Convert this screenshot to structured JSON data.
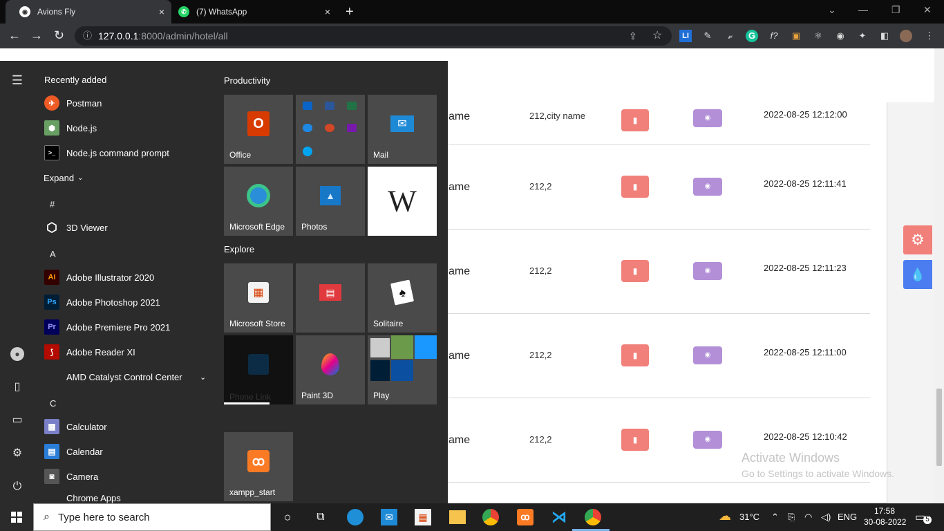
{
  "browser": {
    "tabs": [
      {
        "title": "Avions Fly",
        "close": "×"
      },
      {
        "title": "(7) WhatsApp",
        "close": "×"
      }
    ],
    "new_tab": "+",
    "window_controls": {
      "dropdown": "⌄",
      "minimize": "—",
      "restore": "❐",
      "close": "✕"
    },
    "url_host": "127.0.0.1",
    "url_path": ":8000/admin/hotel/all"
  },
  "table_rows": [
    {
      "name": "ame",
      "city": "212,city name",
      "date": "2022-08-25 12:12:00"
    },
    {
      "name": "ame",
      "city": "212,2",
      "date": "2022-08-25 12:11:41"
    },
    {
      "name": "ame",
      "city": "212,2",
      "date": "2022-08-25 12:11:23"
    },
    {
      "name": "ame",
      "city": "212,2",
      "date": "2022-08-25 12:11:00"
    },
    {
      "name": "ame",
      "city": "212,2",
      "date": "2022-08-25 12:10:42"
    }
  ],
  "watermark": {
    "line1": "Activate Windows",
    "line2": "Go to Settings to activate Windows."
  },
  "start_menu": {
    "recently_added": "Recently added",
    "expand": "Expand",
    "apps": [
      {
        "label": "Postman",
        "icon": "postman-icon",
        "color": "#ef5b25"
      },
      {
        "label": "Node.js",
        "icon": "nodejs-icon",
        "color": "#68a063"
      },
      {
        "label": "Node.js command prompt",
        "icon": "terminal-icon",
        "color": "#000000"
      }
    ],
    "letters": {
      "hash": "#",
      "a": "A",
      "c": "C"
    },
    "apps_hash": [
      {
        "label": "3D Viewer",
        "icon": "cube-icon"
      }
    ],
    "apps_a": [
      {
        "label": "Adobe Illustrator 2020",
        "abbr": "Ai",
        "color": "#330000",
        "fg": "#ff9a00"
      },
      {
        "label": "Adobe Photoshop 2021",
        "abbr": "Ps",
        "color": "#001e36",
        "fg": "#31a8ff"
      },
      {
        "label": "Adobe Premiere Pro 2021",
        "abbr": "Pr",
        "color": "#00005b",
        "fg": "#9999ff"
      },
      {
        "label": "Adobe Reader XI",
        "abbr": "⟆",
        "color": "#b30b00",
        "fg": "#ffffff"
      },
      {
        "label": "AMD Catalyst Control Center",
        "abbr": "",
        "color": "#2b2b2b",
        "fg": "#ffffff"
      }
    ],
    "apps_c": [
      {
        "label": "Calculator",
        "icon": "calculator-icon"
      },
      {
        "label": "Calendar",
        "icon": "calendar-icon"
      },
      {
        "label": "Camera",
        "icon": "camera-icon"
      },
      {
        "label": "Chrome Apps",
        "icon": ""
      }
    ],
    "productivity": "Productivity",
    "explore": "Explore",
    "tiles": {
      "office": "Office",
      "mail": "Mail",
      "edge": "Microsoft Edge",
      "photos": "Photos",
      "wikipedia": "W",
      "store": "Microsoft Store",
      "solitaire": "Solitaire",
      "phone_link": "Phone Link",
      "paint3d": "Paint 3D",
      "play": "Play",
      "xampp": "xampp_start"
    }
  },
  "taskbar": {
    "search_placeholder": "Type here to search",
    "weather": "31°C",
    "lang": "ENG",
    "time": "17:58",
    "date": "30-08-2022",
    "notifications": "5"
  },
  "colors": {
    "delete_btn": "#f1807a",
    "view_btn": "#b38fd8",
    "gear_fab": "#f1807a",
    "drop_fab": "#4c7df0"
  }
}
